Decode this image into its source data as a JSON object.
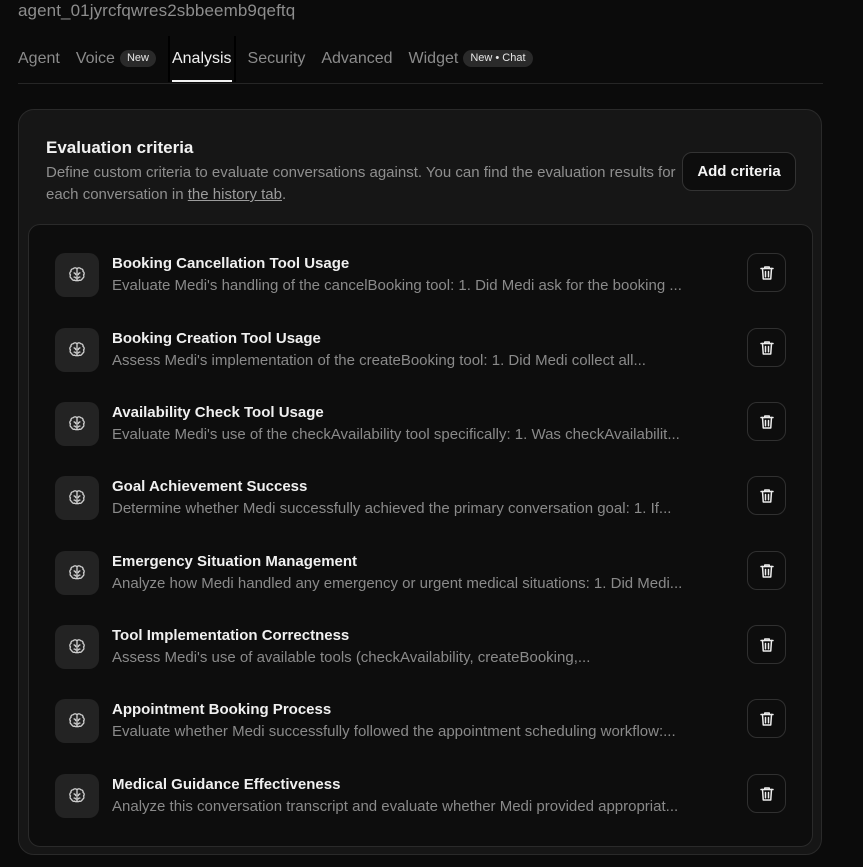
{
  "agent_id": "agent_01jyrcfqwres2sbbeemb9qeftq",
  "tabs": [
    {
      "label": "Agent",
      "badge": ""
    },
    {
      "label": "Voice",
      "badge": "New"
    },
    {
      "label": "Analysis",
      "badge": ""
    },
    {
      "label": "Security",
      "badge": ""
    },
    {
      "label": "Advanced",
      "badge": ""
    },
    {
      "label": "Widget",
      "badge": "New • Chat"
    }
  ],
  "active_tab": "Analysis",
  "evaluation": {
    "title": "Evaluation criteria",
    "description_prefix": "Define custom criteria to evaluate conversations against. You can find the evaluation results for each conversation in ",
    "description_link": "the history tab",
    "description_suffix": ".",
    "add_button": "Add criteria",
    "criteria": [
      {
        "name": "Booking Cancellation Tool Usage",
        "description": "Evaluate Medi's handling of the cancelBooking tool: 1. Did Medi ask for the booking ..."
      },
      {
        "name": "Booking Creation Tool Usage",
        "description": "Assess Medi's implementation of the createBooking tool: 1. Did Medi collect all..."
      },
      {
        "name": "Availability Check Tool Usage",
        "description": "Evaluate Medi's use of the checkAvailability tool specifically: 1. Was checkAvailabilit..."
      },
      {
        "name": "Goal Achievement Success",
        "description": "Determine whether Medi successfully achieved the primary conversation goal: 1. If..."
      },
      {
        "name": "Emergency Situation Management",
        "description": "Analyze how Medi handled any emergency or urgent medical situations: 1. Did Medi..."
      },
      {
        "name": "Tool Implementation Correctness",
        "description": "Assess Medi's use of available tools (checkAvailability, createBooking,..."
      },
      {
        "name": "Appointment Booking Process",
        "description": "Evaluate whether Medi successfully followed the appointment scheduling workflow:..."
      },
      {
        "name": "Medical Guidance Effectiveness",
        "description": "Analyze this conversation transcript and evaluate whether Medi provided appropriat..."
      }
    ]
  },
  "icons": {
    "criteria": "brain-icon",
    "delete": "trash-icon"
  }
}
